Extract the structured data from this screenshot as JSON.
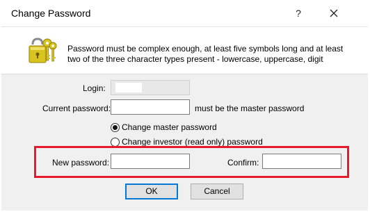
{
  "window": {
    "title": "Change Password",
    "help_label": "?",
    "close_label": "✕"
  },
  "info": {
    "icon": "keys-icon",
    "text": "Password must be complex enough, at least five symbols long and at least two of the three character types present - lowercase, uppercase, digit"
  },
  "form": {
    "login_label": "Login:",
    "login_value": "",
    "current_password_label": "Current password:",
    "current_password_value": "",
    "current_password_hint": "must be the master password",
    "radio_master_label": "Change master password",
    "radio_investor_label": "Change investor (read only) password",
    "selected_option": "master",
    "new_password_label": "New password:",
    "new_password_value": "",
    "confirm_label": "Confirm:",
    "confirm_value": ""
  },
  "buttons": {
    "ok_label": "OK",
    "cancel_label": "Cancel"
  },
  "colors": {
    "highlight": "#e8192c",
    "default_button_border": "#0078d7"
  }
}
